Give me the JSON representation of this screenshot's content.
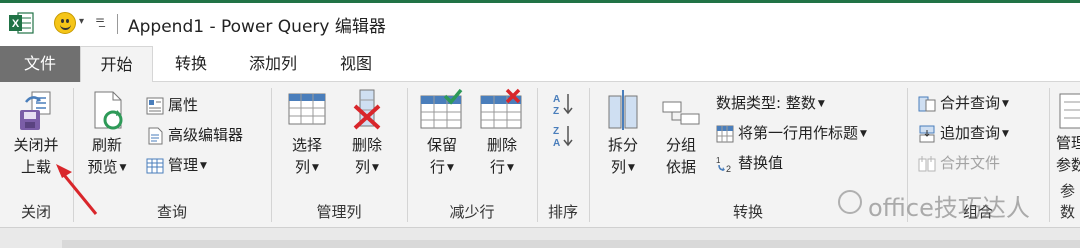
{
  "titlebar": {
    "title": "Append1 - Power Query 编辑器",
    "qat_caret": "▾",
    "qat_customize": "=̲"
  },
  "tabs": [
    {
      "label": "文件"
    },
    {
      "label": "开始"
    },
    {
      "label": "转换"
    },
    {
      "label": "添加列"
    },
    {
      "label": "视图"
    }
  ],
  "ribbon": {
    "close_group": {
      "label": "关闭",
      "close_load": {
        "line1": "关闭并",
        "line2": "上载"
      }
    },
    "query_group": {
      "label": "查询",
      "refresh_preview": {
        "line1": "刷新",
        "line2": "预览"
      },
      "properties": "属性",
      "advanced_editor": "高级编辑器",
      "manage": "管理"
    },
    "manage_columns_group": {
      "label": "管理列",
      "choose_columns": {
        "line1": "选择",
        "line2": "列"
      },
      "remove_columns": {
        "line1": "删除",
        "line2": "列"
      }
    },
    "reduce_rows_group": {
      "label": "减少行",
      "keep_rows": {
        "line1": "保留",
        "line2": "行"
      },
      "remove_rows": {
        "line1": "删除",
        "line2": "行"
      }
    },
    "sort_group": {
      "label": "排序"
    },
    "transform_group": {
      "label": "转换",
      "split_column": {
        "line1": "拆分",
        "line2": "列"
      },
      "group_by": {
        "line1": "分组",
        "line2": "依据"
      },
      "data_type": "数据类型: 整数",
      "use_first_row": "将第一行用作标题",
      "replace_values": "替换值"
    },
    "combine_group": {
      "label": "组合",
      "merge_queries": "合并查询",
      "append_queries": "追加查询",
      "combine_files": "合并文件"
    },
    "params_group": {
      "label": "参数",
      "manage_params": {
        "line1": "管理",
        "line2": "参数"
      }
    }
  },
  "watermark": "office技巧达人",
  "colors": {
    "excel_green": "#217346",
    "file_tab": "#707070",
    "ribbon_bg": "#f3f3f3",
    "arrow_red": "#d9262b",
    "check_green": "#2e9a58",
    "delete_red": "#d9262b",
    "table_blue": "#4a7ebb"
  }
}
